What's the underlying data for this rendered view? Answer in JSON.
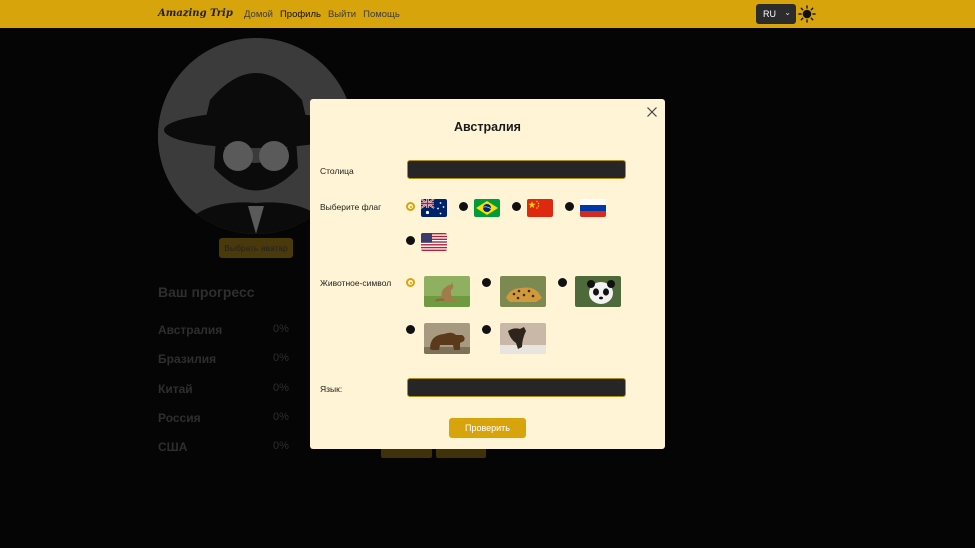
{
  "navbar": {
    "logo": "Amazing Trip",
    "links": [
      "Домой",
      "Профиль",
      "Выйти",
      "Помощь"
    ],
    "active_link": "Профиль",
    "language": "RU",
    "theme_icon": "sun-icon"
  },
  "background": {
    "avatar_button": "Выбрать аватар",
    "progress_title": "Ваш прогресс",
    "progress": [
      {
        "country": "Австралия",
        "percent": "0%"
      },
      {
        "country": "Бразилия",
        "percent": "0%"
      },
      {
        "country": "Китай",
        "percent": "0%"
      },
      {
        "country": "Россия",
        "percent": "0%"
      },
      {
        "country": "США",
        "percent": "0%"
      }
    ]
  },
  "modal": {
    "title": "Австралия",
    "capital_label": "Столица",
    "capital_value": "",
    "flag_label": "Выберите флаг",
    "flags": [
      {
        "icon": "australia-flag-icon",
        "selected": true
      },
      {
        "icon": "brazil-flag-icon",
        "selected": false
      },
      {
        "icon": "china-flag-icon",
        "selected": false
      },
      {
        "icon": "russia-flag-icon",
        "selected": false
      },
      {
        "icon": "usa-flag-icon",
        "selected": false
      }
    ],
    "animal_label": "Животное-символ",
    "animals": [
      {
        "icon": "kangaroo-image",
        "selected": true
      },
      {
        "icon": "jaguar-image",
        "selected": false
      },
      {
        "icon": "panda-image",
        "selected": false
      },
      {
        "icon": "brown-bear-image",
        "selected": false
      },
      {
        "icon": "eagle-image",
        "selected": false
      }
    ],
    "language_label": "Язык:",
    "language_value": "",
    "submit_label": "Проверить"
  },
  "colors": {
    "accent": "#d8a40c",
    "modal_bg": "#fff5d6",
    "input_bg": "#262626",
    "overlay": "#050505"
  }
}
